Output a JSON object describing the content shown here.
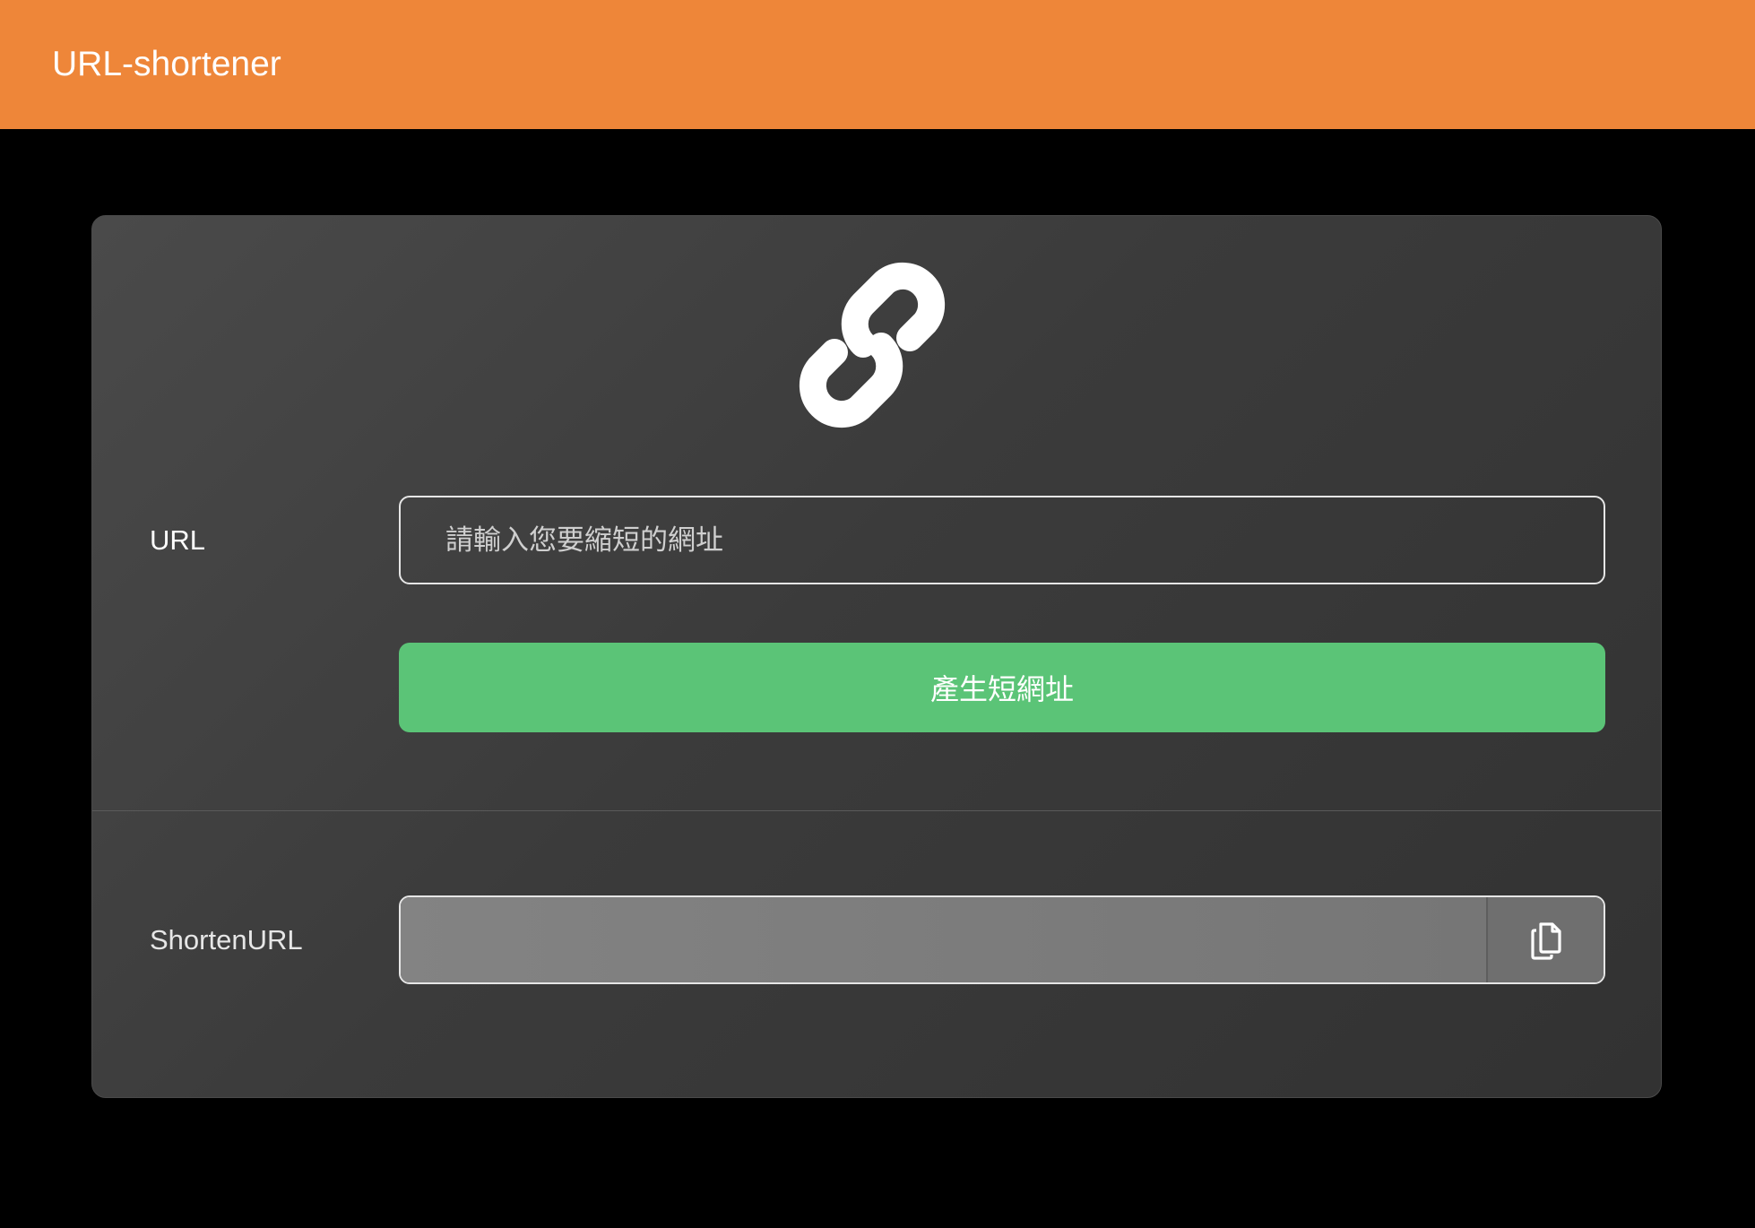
{
  "navbar": {
    "brand": "URL-shortener",
    "color": "#ee8639"
  },
  "form": {
    "logo_icon": "link-icon",
    "url_label": "URL",
    "url_placeholder": "請輸入您要縮短的網址",
    "url_value": "",
    "submit_label": "產生短網址",
    "submit_color": "#5bc477"
  },
  "result": {
    "label": "ShortenURL",
    "value": "",
    "copy_icon": "copy-icon"
  }
}
